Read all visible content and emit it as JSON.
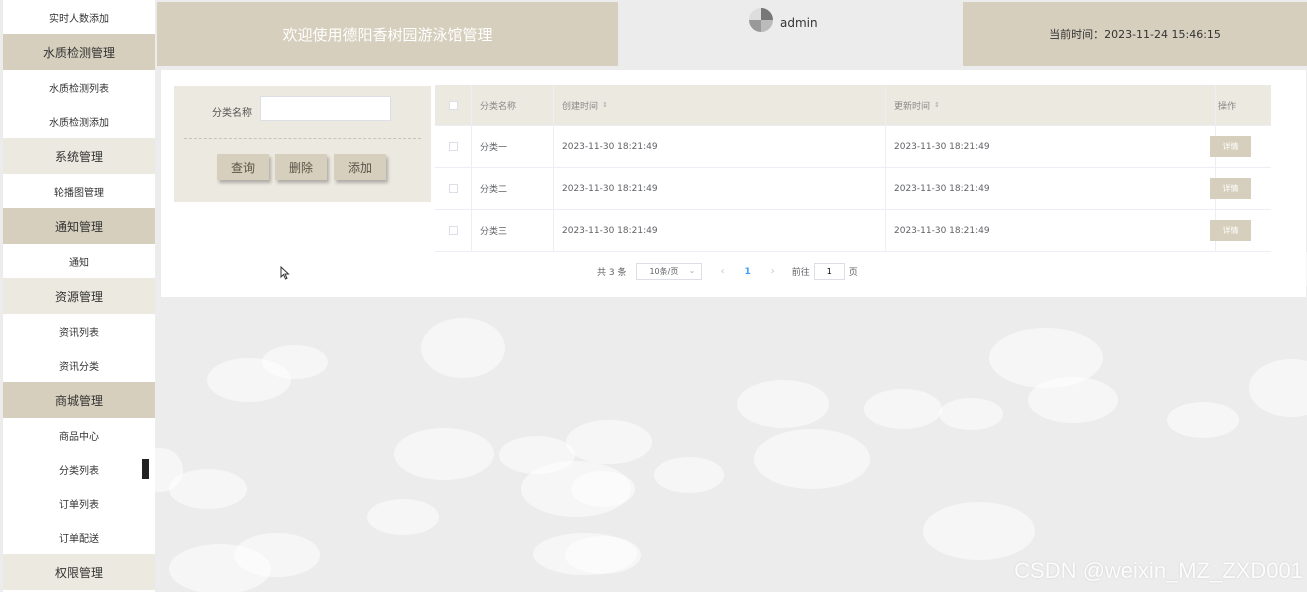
{
  "sidebar": {
    "items": [
      {
        "label": "实时人数添加",
        "kind": "item"
      },
      {
        "label": "水质检测管理",
        "kind": "group-accent"
      },
      {
        "label": "水质检测列表",
        "kind": "item"
      },
      {
        "label": "水质检测添加",
        "kind": "item"
      },
      {
        "label": "系统管理",
        "kind": "group"
      },
      {
        "label": "轮播图管理",
        "kind": "item"
      },
      {
        "label": "通知管理",
        "kind": "group-accent"
      },
      {
        "label": "通知",
        "kind": "item"
      },
      {
        "label": "资源管理",
        "kind": "group"
      },
      {
        "label": "资讯列表",
        "kind": "item"
      },
      {
        "label": "资讯分类",
        "kind": "item"
      },
      {
        "label": "商城管理",
        "kind": "group-accent"
      },
      {
        "label": "商品中心",
        "kind": "item"
      },
      {
        "label": "分类列表",
        "kind": "item-active"
      },
      {
        "label": "订单列表",
        "kind": "item"
      },
      {
        "label": "订单配送",
        "kind": "item"
      },
      {
        "label": "权限管理",
        "kind": "group"
      }
    ]
  },
  "header": {
    "title": "欢迎使用德阳香树园游泳馆管理",
    "username": "admin",
    "time_label": "当前时间：2023-11-24 15:46:15"
  },
  "filter": {
    "label": "分类名称",
    "value": "",
    "placeholder": "",
    "buttons": {
      "query": "查询",
      "delete": "删除",
      "add": "添加"
    }
  },
  "table": {
    "columns": [
      "分类名称",
      "创建时间",
      "更新时间",
      "操作"
    ],
    "sort_icon": "⇕",
    "rows": [
      {
        "name": "分类一",
        "created": "2023-11-30 18:21:49",
        "updated": "2023-11-30 18:21:49",
        "action": "详情"
      },
      {
        "name": "分类二",
        "created": "2023-11-30 18:21:49",
        "updated": "2023-11-30 18:21:49",
        "action": "详情"
      },
      {
        "name": "分类三",
        "created": "2023-11-30 18:21:49",
        "updated": "2023-11-30 18:21:49",
        "action": "详情"
      }
    ]
  },
  "pagination": {
    "total": "共 3 条",
    "page_size": "10条/页",
    "prev": "‹",
    "current": "1",
    "next": "›",
    "goto_label": "前往",
    "goto_value": "1",
    "page_unit": "页"
  },
  "watermark": "CSDN @weixin_MZ_ZXD001",
  "colors": {
    "accent": "#d6cfbd",
    "panel": "#ece9e0",
    "link": "#409eff"
  }
}
